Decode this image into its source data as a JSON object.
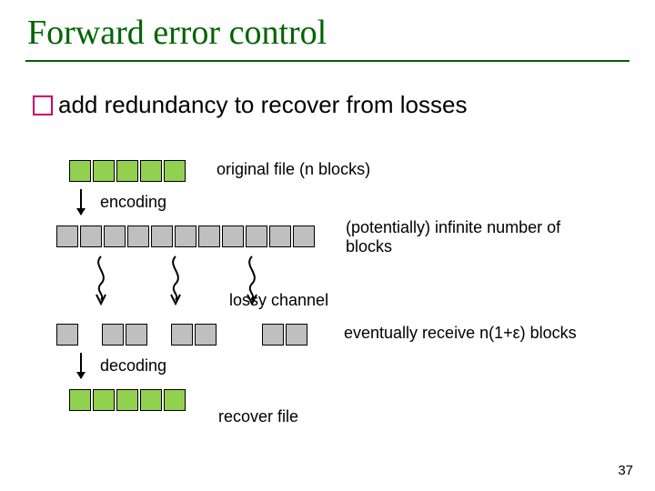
{
  "title": "Forward error control",
  "bullet": "add redundancy to recover from losses",
  "labels": {
    "original": "original file (n blocks)",
    "encoding": "encoding",
    "infinite": "(potentially) infinite number of blocks",
    "lossy": "lossy channel",
    "receive": "eventually receive  n(1+ε) blocks",
    "decoding": "decoding",
    "recover": "recover file"
  },
  "slide_number": "37",
  "colors": {
    "accent": "#006400",
    "bullet_border": "#cc0066",
    "block_green": "#92d050",
    "block_gray": "#bfbfbf"
  }
}
